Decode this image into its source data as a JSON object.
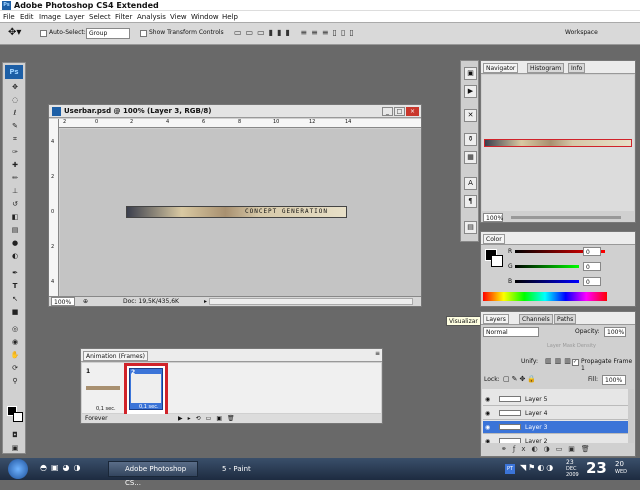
{
  "app": {
    "title": "Adobe Photoshop CS4 Extended",
    "logo": "Ps"
  },
  "menu": [
    "File",
    "Edit",
    "Image",
    "Layer",
    "Select",
    "Filter",
    "Analysis",
    "View",
    "Window",
    "Help"
  ],
  "options": {
    "auto_select_label": "Auto-Select:",
    "auto_select_value": "Group",
    "transform_label": "Show Transform Controls",
    "workspace_label": "Workspace"
  },
  "document": {
    "title": "Userbar.psd @ 100% (Layer 3, RGB/8)",
    "zoom": "100%",
    "doc_info": "Doc: 19,5K/435,6K",
    "ruler_h": [
      "2",
      "0",
      "2",
      "4",
      "6",
      "8",
      "10",
      "12",
      "14"
    ],
    "ruler_v": [
      "4",
      "2",
      "0",
      "2",
      "4"
    ],
    "userbar_text": "CONCEPT GENERATION"
  },
  "navigator": {
    "tabs": [
      "Navigator",
      "Histogram",
      "Info"
    ],
    "zoom": "100%"
  },
  "color": {
    "tab": "Color",
    "r": "0",
    "g": "0",
    "b": "0",
    "labels": [
      "R",
      "G",
      "B"
    ]
  },
  "layers": {
    "tabs": [
      "Layers",
      "Channels",
      "Paths"
    ],
    "blend": "Normal",
    "opacity_label": "Opacity:",
    "opacity": "100%",
    "layer_mask_density": "Layer Mask Density",
    "unify_label": "Unify:",
    "propagate_label": "Propagate Frame 1",
    "lock_label": "Lock:",
    "fill_label": "Fill:",
    "fill": "100%",
    "rows": [
      {
        "name": "Layer 5"
      },
      {
        "name": "Layer 4"
      },
      {
        "name": "Layer 3"
      },
      {
        "name": "Layer 2"
      }
    ]
  },
  "tooltip": "Visualizar",
  "animation": {
    "title": "Animation (Frames)",
    "frames": [
      {
        "num": "1",
        "delay": "0,1 sec."
      },
      {
        "num": "2",
        "delay": "0,1 sec."
      }
    ],
    "loop": "Forever"
  },
  "taskbar": {
    "items": [
      "Adobe Photoshop CS...",
      "5 - Paint"
    ],
    "lang": "PT",
    "clock_day": "23",
    "clock_month": "DEC",
    "clock_year": "2009",
    "clock_big": "23",
    "clock_min": "20",
    "clock_weekday": "WED"
  },
  "colors": {
    "highlight": "#3b74d8",
    "frame_select": "#d0232a"
  }
}
